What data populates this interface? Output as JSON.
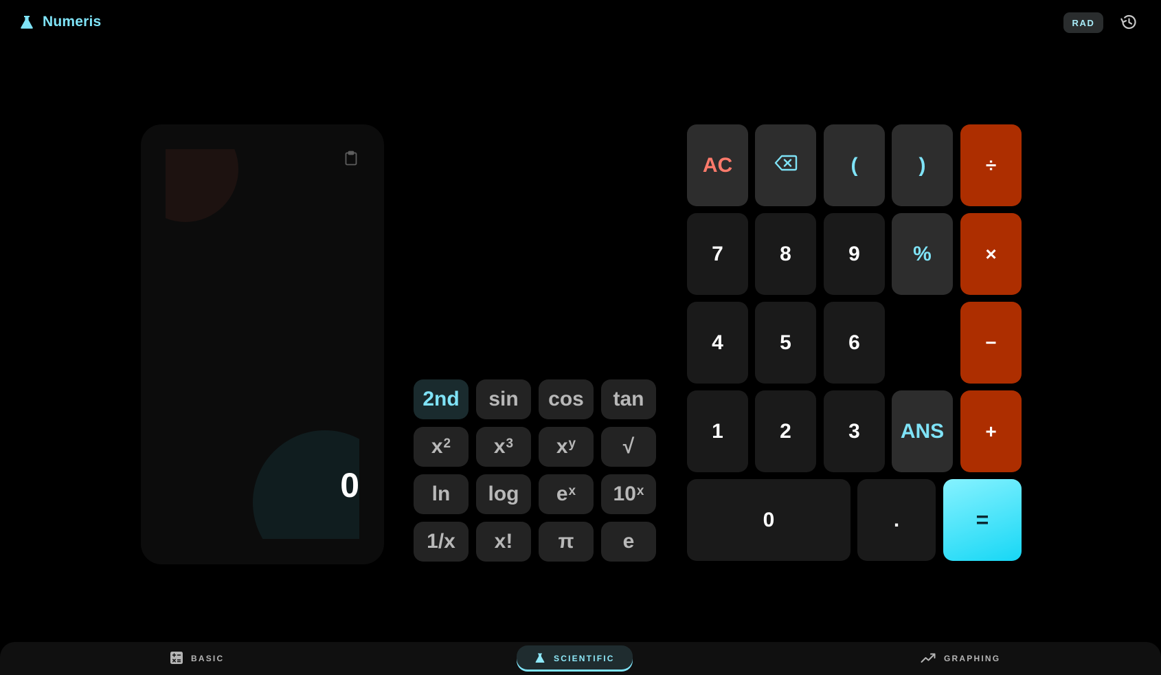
{
  "app": {
    "title": "Numeris",
    "logo_icon": "flask-icon"
  },
  "header": {
    "angle_mode": "RAD",
    "history_icon": "history-icon"
  },
  "display": {
    "value": "0",
    "copy_icon": "clipboard-icon"
  },
  "scientific": {
    "keys": [
      {
        "label": "2nd",
        "accent": true
      },
      {
        "label": "sin"
      },
      {
        "label": "cos"
      },
      {
        "label": "tan"
      },
      {
        "label": "x",
        "sup": "2"
      },
      {
        "label": "x",
        "sup": "3"
      },
      {
        "label": "x",
        "sup": "y"
      },
      {
        "label": "√"
      },
      {
        "label": "ln"
      },
      {
        "label": "log"
      },
      {
        "label": "e",
        "sup": "x"
      },
      {
        "label": "10",
        "sup": "x"
      },
      {
        "label": "1/x"
      },
      {
        "label": "x!"
      },
      {
        "label": "π"
      },
      {
        "label": "e"
      }
    ]
  },
  "keypad": {
    "clear": "AC",
    "backspace_icon": "backspace-icon",
    "open_paren": "(",
    "close_paren": ")",
    "divide": "÷",
    "multiply": "×",
    "subtract": "−",
    "add": "+",
    "percent": "%",
    "answer": "ANS",
    "decimal": ".",
    "equals": "=",
    "digits": [
      "0",
      "1",
      "2",
      "3",
      "4",
      "5",
      "6",
      "7",
      "8",
      "9"
    ]
  },
  "nav": {
    "items": [
      {
        "label": "BASIC",
        "icon": "calculator-icon",
        "active": false
      },
      {
        "label": "SCIENTIFIC",
        "icon": "flask-icon",
        "active": true
      },
      {
        "label": "GRAPHING",
        "icon": "trending-line-icon",
        "active": false
      }
    ]
  },
  "colors": {
    "accent": "#7fe3f7",
    "operator": "#ad2e00",
    "clear": "#ff7a6b",
    "background": "#000000"
  }
}
